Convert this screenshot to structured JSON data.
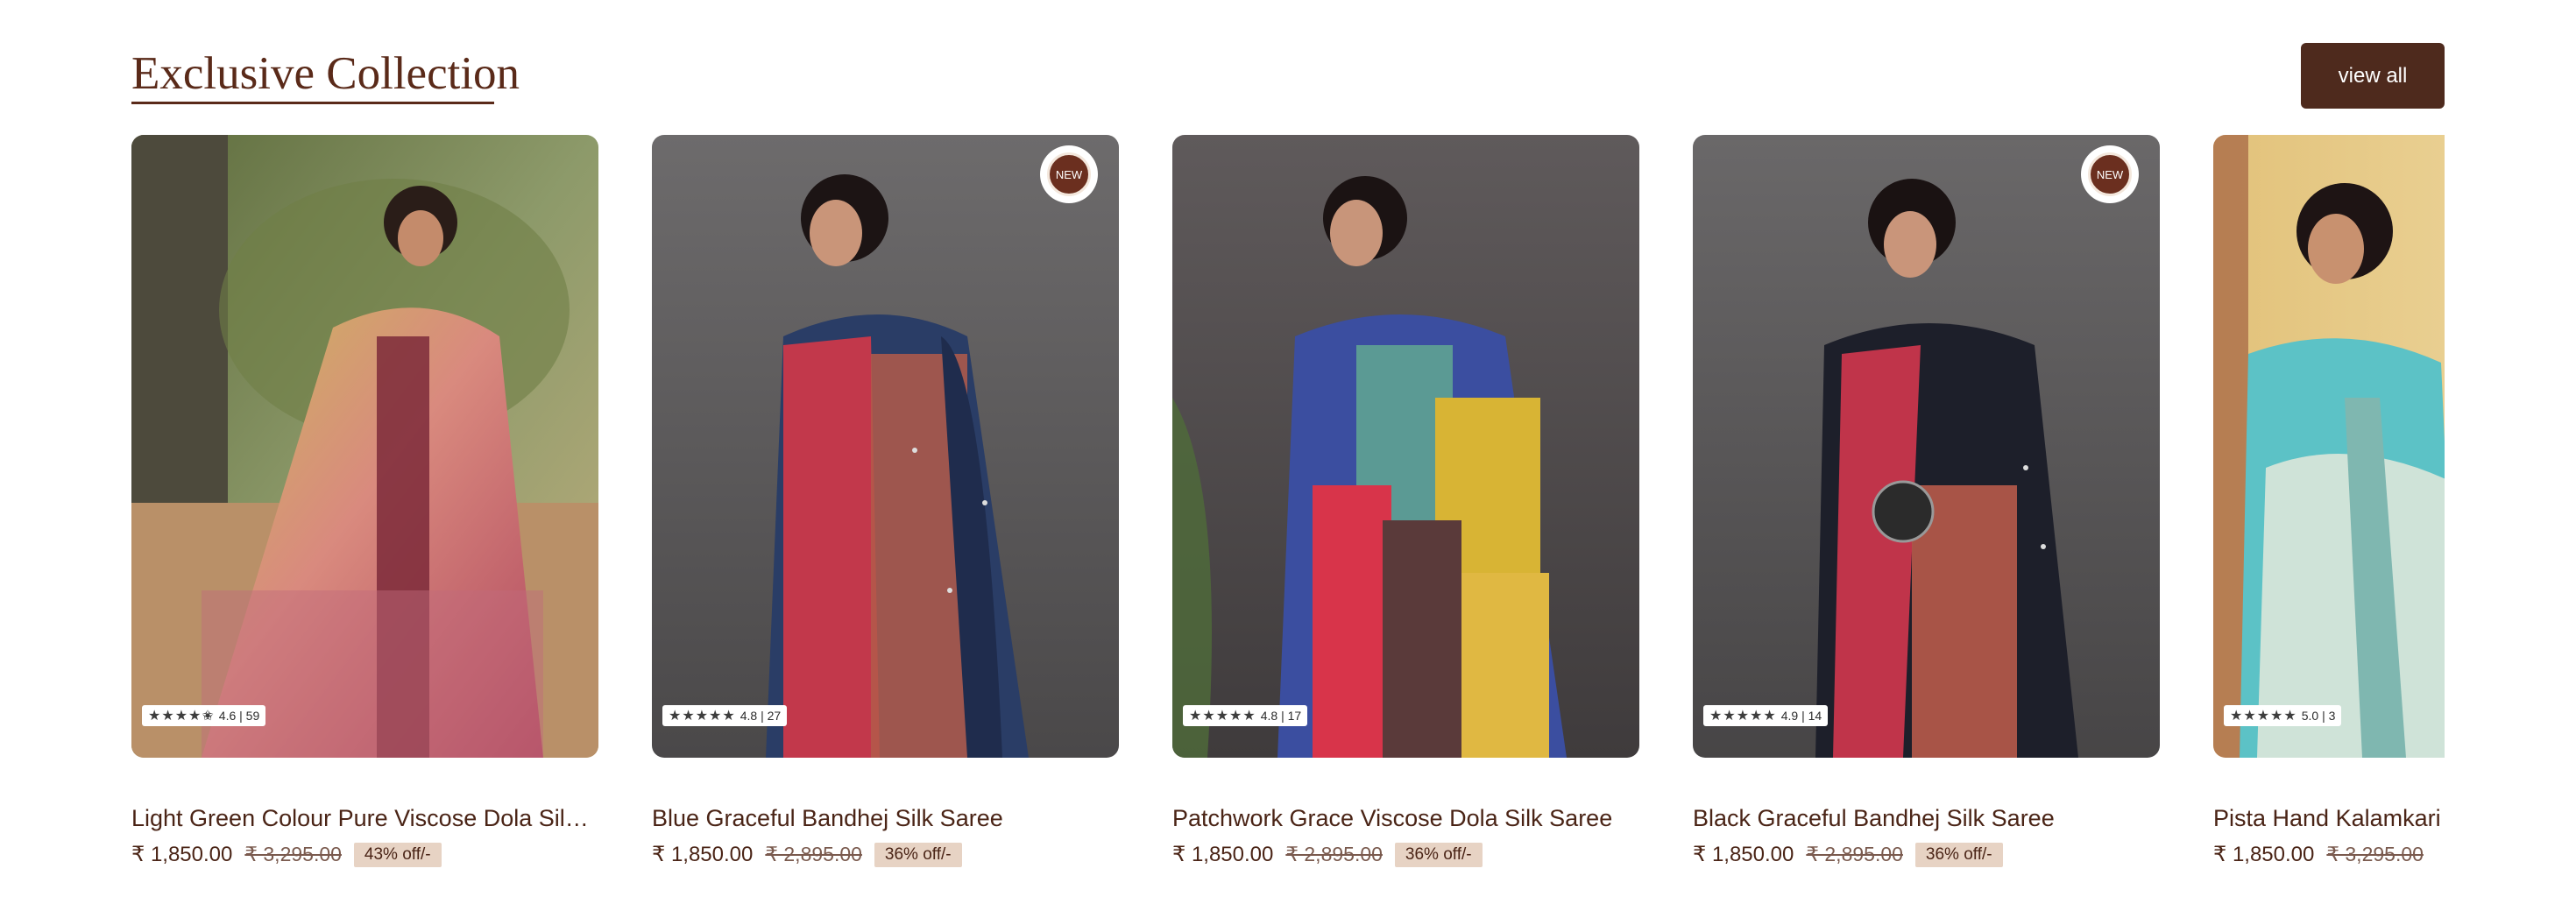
{
  "section": {
    "title": "Exclusive Collection",
    "view_all_label": "view all"
  },
  "colors": {
    "brand": "#4e2a1d",
    "title": "#5a2a19",
    "discount_bg": "#e7d3c4"
  },
  "products": [
    {
      "name": "Light Green Colour Pure Viscose Dola Silk Saree",
      "price": "₹ 1,850.00",
      "mrp": "₹ 3,295.00",
      "discount": "43% off/-",
      "rating_text": "4.6 | 59",
      "rating": 4.6,
      "stars": "★★★★✬",
      "new": false
    },
    {
      "name": "Blue Graceful Bandhej Silk Saree",
      "price": "₹ 1,850.00",
      "mrp": "₹ 2,895.00",
      "discount": "36% off/-",
      "rating_text": "4.8 | 27",
      "rating": 4.8,
      "stars": "★★★★★",
      "new": true,
      "badge_label": "NEW"
    },
    {
      "name": "Patchwork Grace Viscose Dola Silk Saree",
      "price": "₹ 1,850.00",
      "mrp": "₹ 2,895.00",
      "discount": "36% off/-",
      "rating_text": "4.8 | 17",
      "rating": 4.8,
      "stars": "★★★★★",
      "new": false
    },
    {
      "name": "Black Graceful Bandhej Silk Saree",
      "price": "₹ 1,850.00",
      "mrp": "₹ 2,895.00",
      "discount": "36% off/-",
      "rating_text": "4.9 | 14",
      "rating": 4.9,
      "stars": "★★★★★",
      "new": true,
      "badge_label": "NEW"
    },
    {
      "name": "Pista Hand Kalamkari Pure Viscose Saree",
      "price": "₹ 1,850.00",
      "mrp": "₹ 3,295.00",
      "discount": "",
      "rating_text": "5.0 | 3",
      "rating": 5.0,
      "stars": "★★★★★",
      "new": false
    }
  ]
}
